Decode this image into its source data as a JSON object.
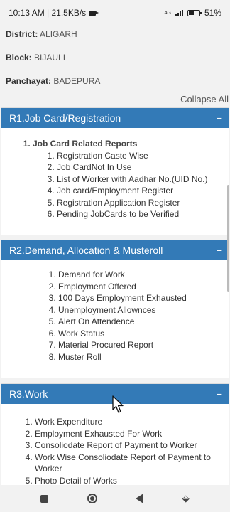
{
  "status_bar": {
    "time": "10:13 AM | 21.5KB/s",
    "network": "4G",
    "battery": "51%",
    "battery_level": 0.51
  },
  "info": {
    "district_label": "District:",
    "district_value": "ALIGARH",
    "block_label": "Block:",
    "block_value": "BIJAULI",
    "panchayat_label": "Panchayat:",
    "panchayat_value": "BADEPURA"
  },
  "collapse_all": "Collapse All",
  "panels": [
    {
      "title": "R1.Job Card/Registration",
      "toggle": "−",
      "group_title": "Job Card Related Reports",
      "items": [
        "Registration Caste Wise",
        "Job CardNot In Use",
        "List of Worker with Aadhar No.(UID No.)",
        "Job card/Employment Register",
        "Registration Application Register",
        "Pending JobCards to be Verified"
      ]
    },
    {
      "title": "R2.Demand, Allocation & Musteroll",
      "toggle": "−",
      "items": [
        "Demand for Work",
        "Employment Offered",
        "100 Days Employment Exhausted",
        "Unemployment Allownces",
        "Alert On Attendence",
        "Work Status",
        "Material Procured Report",
        "Muster Roll"
      ]
    },
    {
      "title": "R3.Work",
      "toggle": "−",
      "items": [
        "Work Expenditure",
        "Employment Exhausted For Work",
        "Consoliodate Report of Payment to Worker",
        "Work Wise Consoliodate Report of Payment to Worker",
        "Photo Detail of Works"
      ]
    }
  ]
}
